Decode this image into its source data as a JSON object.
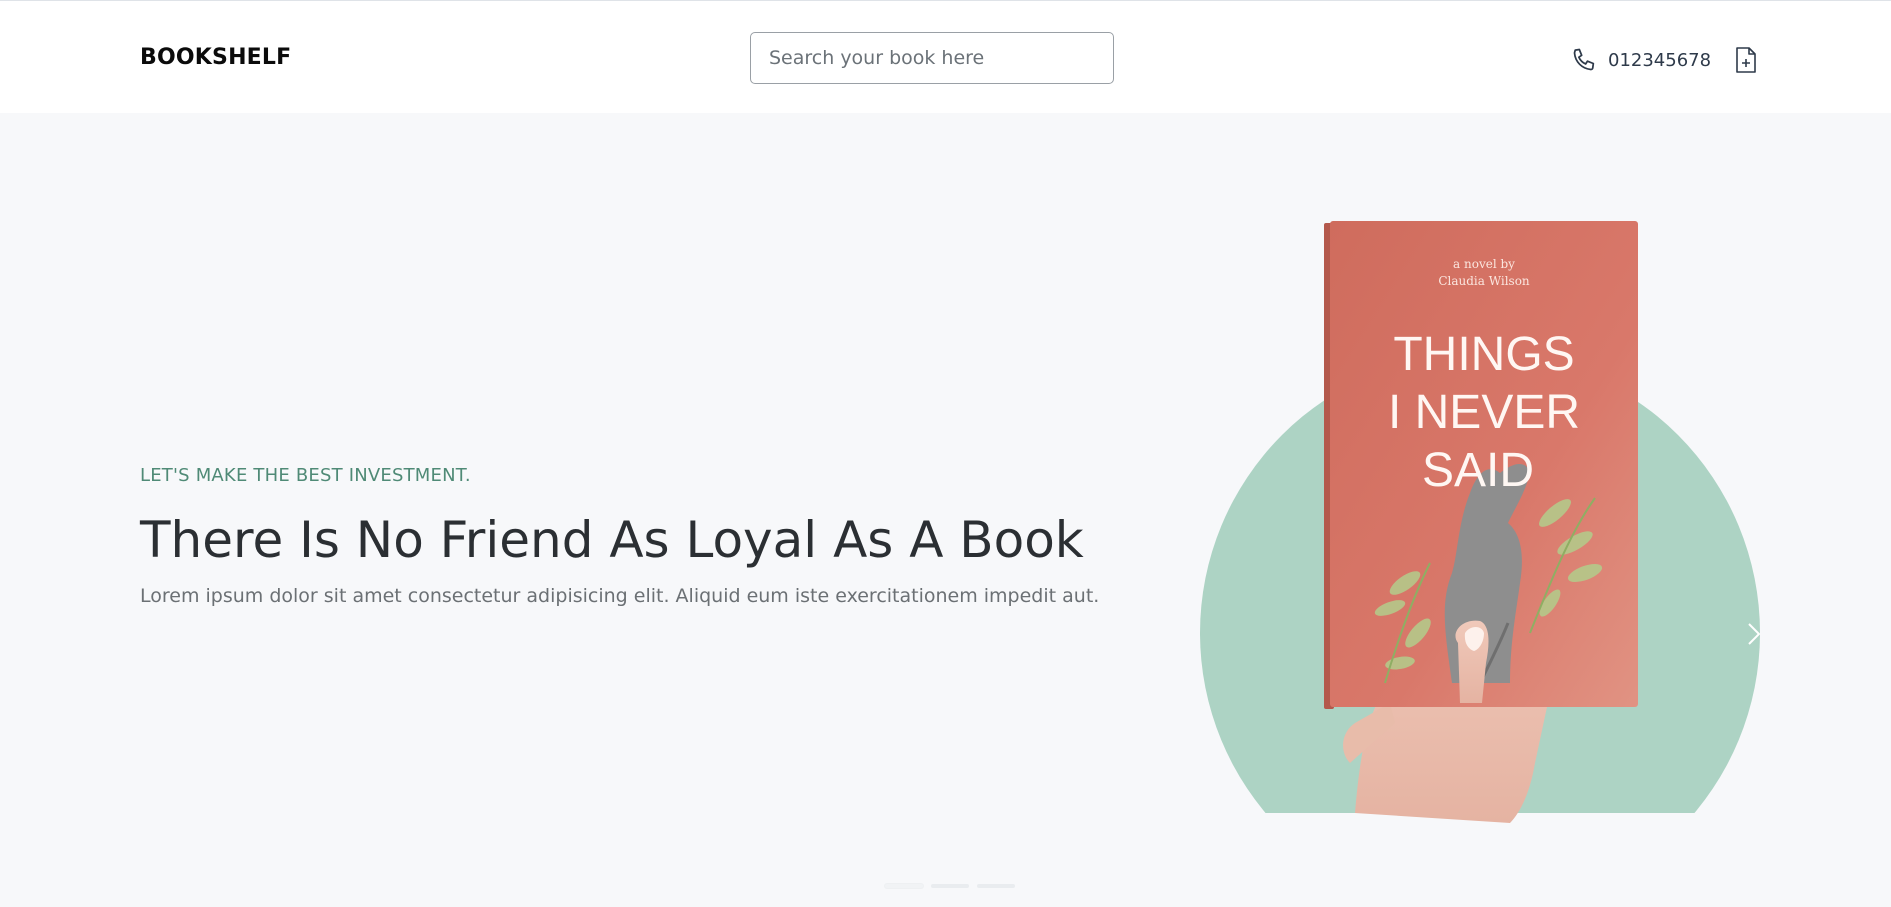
{
  "header": {
    "brand": "BOOKSHELF",
    "search": {
      "placeholder": "Search your book here",
      "value": ""
    },
    "phone": {
      "icon": "phone-icon",
      "number": "012345678"
    },
    "cart_icon": "document-plus-icon"
  },
  "hero": {
    "eyebrow": "LET'S MAKE THE BEST INVESTMENT.",
    "title": "There Is No Friend As Loyal As A Book",
    "subtitle": "Lorem ipsum dolor sit amet consectetur adipisicing elit. Aliquid eum iste exercitationem impedit aut.",
    "book": {
      "byline_1": "a novel by",
      "byline_2": "Claudia Wilson",
      "title_line_1": "THINGS",
      "title_line_2": "I NEVER",
      "title_line_3": "SAID"
    },
    "carousel": {
      "slides": 3,
      "active": 1
    }
  },
  "colors": {
    "accent_green": "#4f8a76",
    "circle": "#add3c4",
    "book_cover": "#d9786a",
    "header_bg": "#ffffff",
    "page_bg": "#f7f8fa"
  }
}
